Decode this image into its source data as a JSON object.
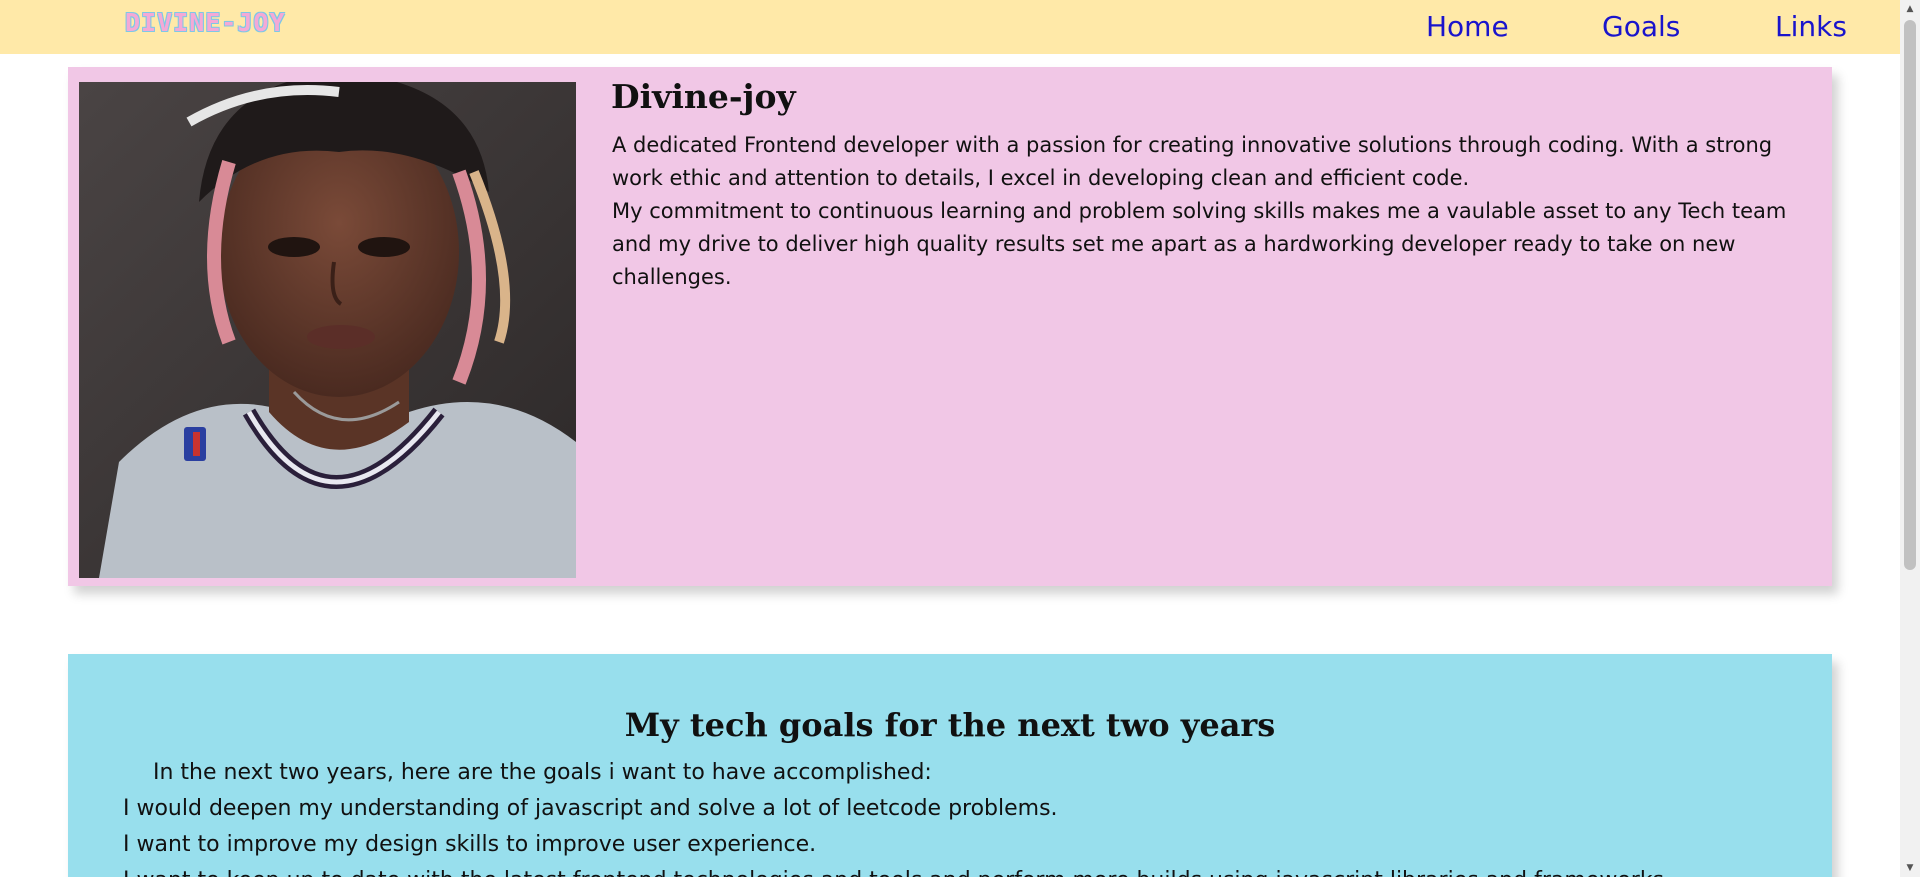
{
  "navbar": {
    "logo": "DIVINE-JOY",
    "links": [
      "Home",
      "Goals",
      "Links"
    ]
  },
  "profile": {
    "name": "Divine-joy",
    "bio": [
      "A dedicated Frontend developer with a passion for creating innovative solutions through coding. With a strong work ethic and attention to details, I excel in developing clean and efficient code.",
      "My commitment to continuous learning and problem solving skills makes me a vaulable asset to any Tech team and my drive to deliver high quality results set me apart as a hardworking developer ready to take on new challenges."
    ]
  },
  "goals": {
    "title": "My tech goals for the next two years",
    "intro": "In the next two years, here are the goals i want to have accomplished:",
    "items": [
      "I would deepen my understanding of javascript and solve a lot of leetcode problems.",
      "I want to improve my design skills to improve user experience.",
      "I want to keep up to date with the latest frontend technologies and tools and perform more builds using javascript libraries and frameworks."
    ]
  },
  "colors": {
    "navbar_bg": "#ffe9a8",
    "nav_link": "#1a14cc",
    "profile_bg": "#f1c7e6",
    "goals_bg": "#98dfed",
    "logo": "#f4a9d6"
  },
  "icons": {
    "scroll_up": "triangle-up-icon",
    "scroll_down": "triangle-down-icon"
  }
}
